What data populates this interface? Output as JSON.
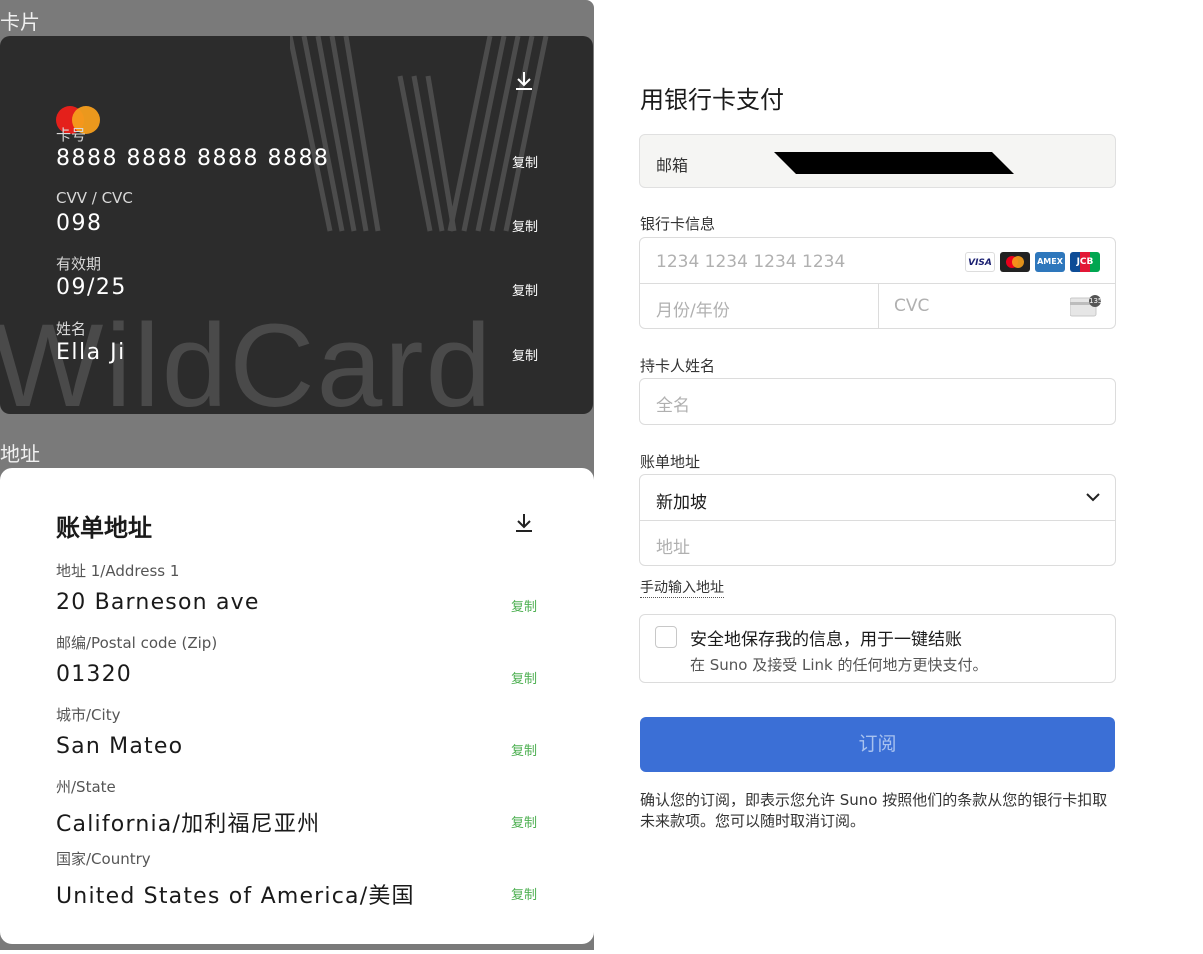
{
  "left": {
    "card_section_title": "卡片",
    "address_section_title": "地址",
    "card": {
      "watermark": "WildCard",
      "number_label": "卡号",
      "number_value": "8888 8888 8888 8888",
      "cvv_label": "CVV / CVC",
      "cvv_value": "098",
      "expiry_label": "有效期",
      "expiry_value": "09/25",
      "name_label": "姓名",
      "name_value": "Ella Ji",
      "copy_label": "复制"
    },
    "address": {
      "title": "账单地址",
      "copy_label": "复制",
      "fields": [
        {
          "label": "地址 1/Address 1",
          "value": "20 Barneson ave"
        },
        {
          "label": "邮编/Postal code (Zip)",
          "value": "01320"
        },
        {
          "label": "城市/City",
          "value": "San Mateo"
        },
        {
          "label": "州/State",
          "value": "California/加利福尼亚州"
        },
        {
          "label": "国家/Country",
          "value": "United States of America/美国"
        }
      ]
    }
  },
  "right": {
    "title": "用银行卡支付",
    "email_label": "邮箱",
    "card_info_label": "银行卡信息",
    "card_number_placeholder": "1234 1234 1234 1234",
    "expiry_placeholder": "月份/年份",
    "cvc_placeholder": "CVC",
    "brands": [
      "VISA",
      "mastercard",
      "AMEX",
      "JCB"
    ],
    "cvc_badge": "135",
    "holder_label": "持卡人姓名",
    "holder_placeholder": "全名",
    "billing_label": "账单地址",
    "country_value": "新加坡",
    "address_placeholder": "地址",
    "manual_link": "手动输入地址",
    "save_title": "安全地保存我的信息，用于一键结账",
    "save_subtitle": "在 Suno 及接受 Link 的任何地方更快支付。",
    "subscribe_button": "订阅",
    "terms": "确认您的订阅，即表示您允许 Suno 按照他们的条款从您的银行卡扣取未来款项。您可以随时取消订阅。"
  }
}
